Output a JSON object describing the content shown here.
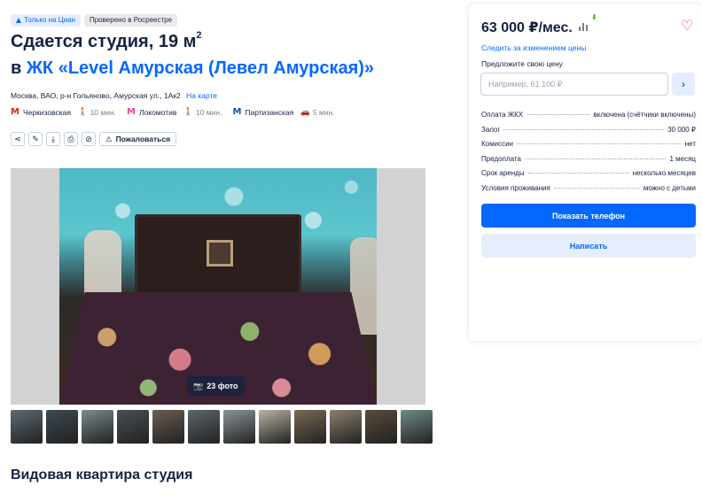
{
  "badges": {
    "cian_only": "Только на Циан",
    "rosreestr": "Проверено в Росреестре"
  },
  "title": {
    "line1": "Сдается студия, 19 м",
    "sup": "2",
    "prefix": "в",
    "complex": "ЖК «Level Амурская (Левел Амурская)»"
  },
  "address": {
    "text": "Москва, ВАО, р-н Гольяново, Амурская ул., 1Ак2",
    "map_link": "На карте"
  },
  "metro": [
    {
      "name": "Черкизовская",
      "time": "10 мин.",
      "mode": "walk",
      "color": "#e42313"
    },
    {
      "name": "Локомотив",
      "time": "10 мин.",
      "mode": "walk",
      "color": "#ef4c85"
    },
    {
      "name": "Партизанская",
      "time": "5 мин.",
      "mode": "car",
      "color": "#0a57a4"
    }
  ],
  "actions": {
    "complain": "Пожаловаться"
  },
  "gallery": {
    "count_label": "23 фото",
    "thumbs": [
      "#5b6a74",
      "#3d4a52",
      "#7b8a8f",
      "#4a4e52",
      "#6a5e55",
      "#5c656d",
      "#8a9498",
      "#b9b2a5",
      "#7a6a54",
      "#8c7f6e",
      "#5a4a3c",
      "#6f8c88"
    ]
  },
  "description": {
    "title": "Видовая квартира студия"
  },
  "sidebar": {
    "price": "63 000 ₽/мес.",
    "follow_link": "Следить за изменением цены",
    "propose_label": "Предложите свою цену",
    "propose_placeholder": "Например, 61 100 ₽",
    "terms": [
      {
        "label": "Оплата ЖКХ",
        "value": "включена (счётчики включены)"
      },
      {
        "label": "Залог",
        "value": "30 000 ₽"
      },
      {
        "label": "Комиссии",
        "value": "нет"
      },
      {
        "label": "Предоплата",
        "value": "1 месяц"
      },
      {
        "label": "Срок аренды",
        "value": "несколько месяцев"
      },
      {
        "label": "Условия проживания",
        "value": "можно с детьми"
      }
    ],
    "show_phone": "Показать телефон",
    "write": "Написать"
  }
}
